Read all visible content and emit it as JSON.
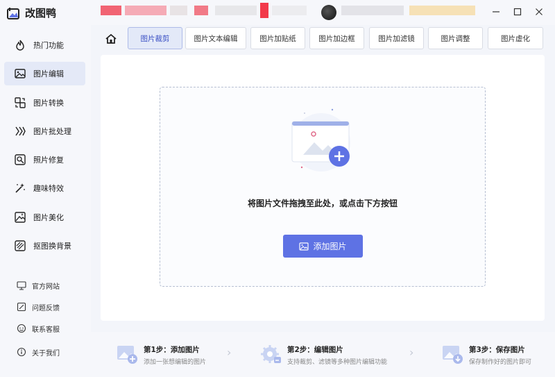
{
  "app": {
    "title": "改图鸭"
  },
  "colors": {
    "accent": "#5e72e4",
    "active_bg": "#e4e9f7"
  },
  "sidebar": {
    "items": [
      {
        "label": "热门功能",
        "icon": "flame-icon"
      },
      {
        "label": "图片编辑",
        "icon": "image-edit-icon",
        "active": true
      },
      {
        "label": "图片转换",
        "icon": "convert-icon"
      },
      {
        "label": "图片批处理",
        "icon": "batch-icon"
      },
      {
        "label": "照片修复",
        "icon": "photo-repair-icon"
      },
      {
        "label": "趣味特效",
        "icon": "magic-wand-icon"
      },
      {
        "label": "图片美化",
        "icon": "beautify-icon"
      },
      {
        "label": "抠图换背景",
        "icon": "cutout-icon"
      }
    ],
    "footer": [
      {
        "label": "官方网站",
        "icon": "monitor-icon"
      },
      {
        "label": "问题反馈",
        "icon": "feedback-icon"
      },
      {
        "label": "联系客服",
        "icon": "support-icon"
      },
      {
        "label": "关于我们",
        "icon": "info-icon"
      }
    ]
  },
  "tabs": [
    {
      "label": "图片裁剪",
      "active": true
    },
    {
      "label": "图片文本编辑"
    },
    {
      "label": "图片加贴纸"
    },
    {
      "label": "图片加边框"
    },
    {
      "label": "图片加滤镜"
    },
    {
      "label": "图片调整"
    },
    {
      "label": "图片虚化"
    }
  ],
  "main": {
    "drop_text": "将图片文件拖拽至此处，或点击下方按钮",
    "add_button": "添加图片"
  },
  "steps": [
    {
      "title": "第1步：添加图片",
      "desc": "添加一张想编辑的图片"
    },
    {
      "title": "第2步：编辑图片",
      "desc": "支持裁剪、滤镜等多种图片编辑功能"
    },
    {
      "title": "第3步：保存图片",
      "desc": "保存制作好的图片即可"
    }
  ]
}
